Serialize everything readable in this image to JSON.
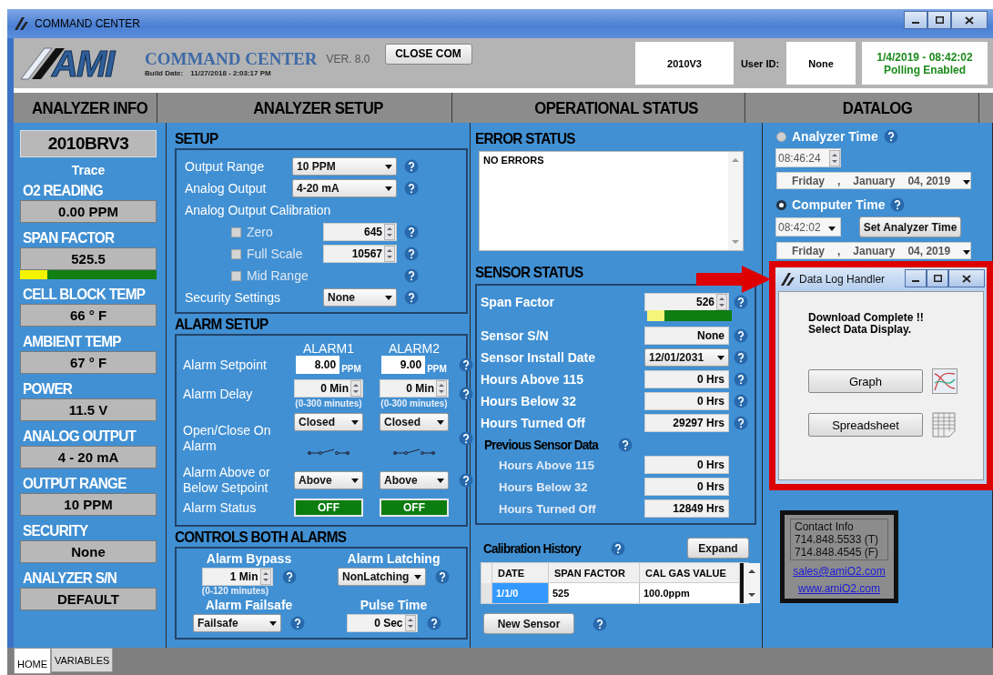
{
  "window": {
    "title": "COMMAND CENTER"
  },
  "header": {
    "logo_text": "AMI",
    "app_name": "COMMAND CENTER",
    "version": "VER. 8.0",
    "build_label": "Build Date:",
    "build_date": "11/27/2018 - 2:03:17 PM",
    "close_button": "CLOSE COM",
    "model": "2010V3",
    "user_label": "User ID:",
    "user_id": "None",
    "datetime": "1/4/2019 - 08:42:02",
    "polling": "Polling Enabled"
  },
  "column_headers": [
    "ANALYZER INFO",
    "ANALYZER SETUP",
    "OPERATIONAL STATUS",
    "DATALOG"
  ],
  "analyzer_info": {
    "model": "2010BRV3",
    "type": "Trace",
    "fields": [
      {
        "label": "O2 READING",
        "value": "0.00 PPM"
      },
      {
        "label": "SPAN FACTOR",
        "value": "525.5",
        "level": 0.2
      },
      {
        "label": "CELL BLOCK TEMP",
        "value": "66 ° F"
      },
      {
        "label": "AMBIENT TEMP",
        "value": "67 ° F"
      },
      {
        "label": "POWER",
        "value": "11.5 V"
      },
      {
        "label": "ANALOG OUTPUT",
        "value": "4 - 20 mA"
      },
      {
        "label": "OUTPUT RANGE",
        "value": "10 PPM"
      },
      {
        "label": "SECURITY",
        "value": "None"
      },
      {
        "label": "ANALYZER S/N",
        "value": "DEFAULT"
      }
    ]
  },
  "setup": {
    "title": "SETUP",
    "rows": [
      {
        "kind": "select",
        "label": "Output Range",
        "value": "10 PPM"
      },
      {
        "kind": "select",
        "label": "Analog Output",
        "value": "4-20 mA"
      },
      {
        "kind": "heading",
        "label": "Analog Output Calibration"
      },
      {
        "kind": "check",
        "label": "Zero",
        "checked": false,
        "value": "645"
      },
      {
        "kind": "check",
        "label": "Full Scale",
        "checked": false,
        "value": "10567"
      },
      {
        "kind": "check",
        "label": "Mid Range",
        "checked": false
      },
      {
        "kind": "small_select",
        "label": "Security Settings",
        "value": "None"
      }
    ]
  },
  "alarm_setup": {
    "title": "ALARM SETUP",
    "alarms": [
      "ALARM1",
      "ALARM2"
    ],
    "rows": [
      {
        "kind": "input",
        "label": "Alarm Setpoint",
        "cells": [
          {
            "value": "8.00",
            "unit": "PPM"
          },
          {
            "value": "9.00",
            "unit": "PPM"
          }
        ]
      },
      {
        "kind": "spin",
        "label": "Alarm Delay",
        "cells": [
          {
            "value": "0 Min",
            "hint": "(0-300 minutes)"
          },
          {
            "value": "0 Min",
            "hint": "(0-300 minutes)"
          }
        ]
      },
      {
        "kind": "relay",
        "label": "Open/Close On Alarm",
        "cells": [
          {
            "value": "Closed"
          },
          {
            "value": "Closed"
          }
        ]
      },
      {
        "kind": "select",
        "label": "Alarm Above or Below Setpoint",
        "cells": [
          {
            "value": "Above"
          },
          {
            "value": "Above"
          }
        ]
      },
      {
        "kind": "status",
        "label": "Alarm Status",
        "cells": [
          {
            "value": "OFF"
          },
          {
            "value": "OFF"
          }
        ]
      }
    ]
  },
  "controls_both": {
    "title": "CONTROLS BOTH ALARMS",
    "items": [
      {
        "kind": "spin",
        "label": "Alarm Bypass",
        "value": "1 Min",
        "hint": "(0-120 minutes)"
      },
      {
        "kind": "select",
        "label": "Alarm Latching",
        "value": "NonLatching"
      },
      {
        "kind": "select",
        "label": "Alarm Failsafe",
        "value": "Failsafe"
      },
      {
        "kind": "spin",
        "label": "Pulse Time",
        "value": "0 Sec"
      }
    ]
  },
  "error_status": {
    "title": "ERROR STATUS",
    "text": "NO ERRORS"
  },
  "sensor_status": {
    "title": "SENSOR STATUS",
    "rows": [
      {
        "kind": "meter",
        "label": "Span Factor",
        "value": "526",
        "level": 0.2
      },
      {
        "kind": "text",
        "label": "Sensor S/N",
        "value": "None"
      },
      {
        "kind": "select",
        "label": "Sensor Install Date",
        "value": "12/01/2031"
      },
      {
        "kind": "text",
        "label": "Hours Above 115",
        "value": "0 Hrs"
      },
      {
        "kind": "text",
        "label": "Hours Below 32",
        "value": "0 Hrs"
      },
      {
        "kind": "text",
        "label": "Hours Turned Off",
        "value": "29297 Hrs"
      }
    ],
    "previous": {
      "title": "Previous Sensor Data",
      "rows": [
        {
          "label": "Hours Above 115",
          "value": "0 Hrs"
        },
        {
          "label": "Hours Below 32",
          "value": "0 Hrs"
        },
        {
          "label": "Hours Turned Off",
          "value": "12849 Hrs"
        }
      ]
    }
  },
  "calibration": {
    "title": "Calibration History",
    "expand": "Expand",
    "columns": [
      "DATE",
      "SPAN FACTOR",
      "CAL GAS VALUE"
    ],
    "rows": [
      {
        "cells": [
          "1/1/0",
          "525",
          "100.0ppm"
        ],
        "selected": true
      }
    ],
    "new_sensor": "New Sensor"
  },
  "datalog": {
    "time_sources": [
      {
        "label": "Analyzer Time",
        "selected": false,
        "time": "08:46:24",
        "kind": "spin",
        "date": [
          "Friday",
          ",",
          "January",
          "04, 2019"
        ]
      },
      {
        "label": "Computer Time",
        "selected": true,
        "time": "08:42:02",
        "kind": "select",
        "button": "Set Analyzer Time",
        "date": [
          "Friday",
          ",",
          "January",
          "04, 2019"
        ]
      }
    ],
    "contact": {
      "title": "Contact Info",
      "lines": [
        "714.848.5533 (T)",
        "714.848.4545 (F)"
      ],
      "links": [
        "sales@amiO2.com",
        "www.amiO2.com"
      ]
    }
  },
  "dialog": {
    "title": "Data Log Handler",
    "message": [
      "Download Complete !!",
      "Select Data Display."
    ],
    "buttons": [
      {
        "label": "Graph",
        "kind": "graph"
      },
      {
        "label": "Spreadsheet",
        "kind": "sheet"
      }
    ]
  },
  "tabs": [
    {
      "label": "HOME",
      "selected": true
    },
    {
      "label": "VARIABLES",
      "selected": false
    }
  ]
}
